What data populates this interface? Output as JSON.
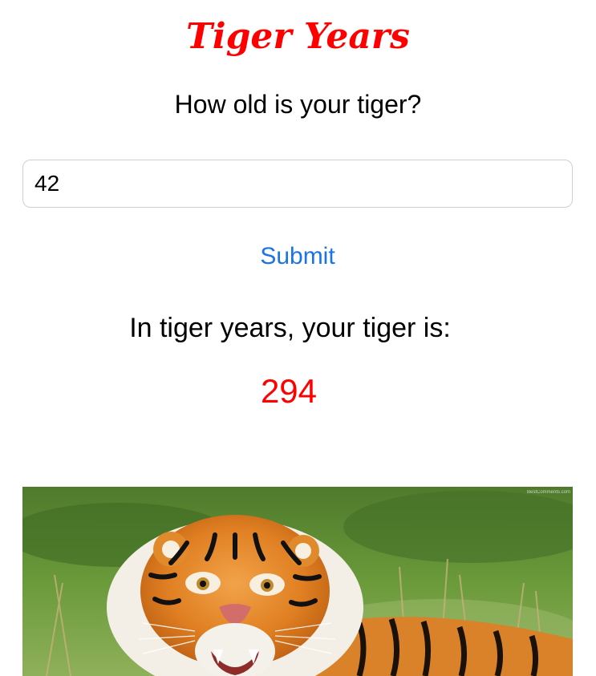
{
  "app": {
    "title": "Tiger Years",
    "accent_color": "#ff0000",
    "link_color": "#1a73e8"
  },
  "form": {
    "question": "How old is your tiger?",
    "age_value": "42",
    "submit_label": "Submit"
  },
  "result": {
    "label": "In tiger years, your tiger is:",
    "value": "294"
  },
  "image": {
    "subject": "tiger",
    "watermark": "BestComments.com"
  }
}
